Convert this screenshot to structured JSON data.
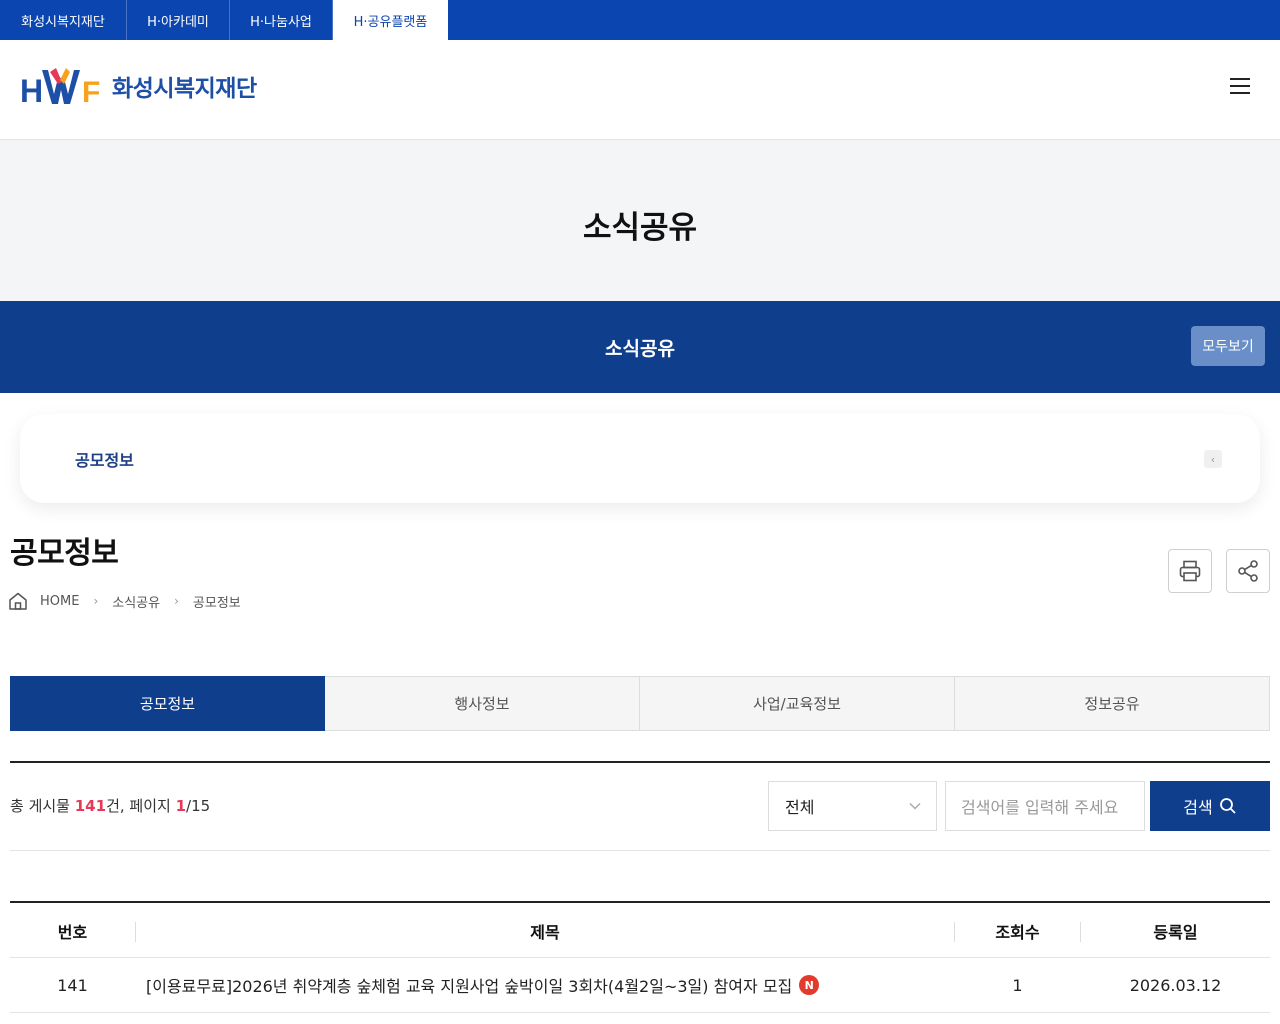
{
  "topbar": {
    "tabs": [
      {
        "label": "화성시복지재단"
      },
      {
        "label": "H·아카데미"
      },
      {
        "label": "H·나눔사업"
      },
      {
        "label": "H·공유플랫폼"
      }
    ]
  },
  "header": {
    "logo_text": "화성시복지재단",
    "logo_mark": "HWF"
  },
  "visual": {
    "title": "소식공유"
  },
  "subbar": {
    "title": "소식공유",
    "all_button": "모두보기"
  },
  "submenu": {
    "current": "공모정보"
  },
  "page": {
    "title": "공모정보"
  },
  "breadcrumb": {
    "home": "HOME",
    "level1": "소식공유",
    "level2": "공모정보"
  },
  "tabs": [
    {
      "label": "공모정보"
    },
    {
      "label": "행사정보"
    },
    {
      "label": "사업/교육정보"
    },
    {
      "label": "정보공유"
    }
  ],
  "board": {
    "count_prefix": "총 게시물 ",
    "total": "141",
    "count_mid": "건, 페이지 ",
    "page_current": "1",
    "page_total": "/15",
    "select_value": "전체",
    "search_placeholder": "검색어를 입력해 주세요",
    "search_button": "검색"
  },
  "table": {
    "headers": [
      "번호",
      "제목",
      "조회수",
      "등록일"
    ],
    "rows": [
      {
        "no": "141",
        "title": "[이용료무료]2026년 취약계층 숲체험 교육 지원사업 숲박이일 3회차(4월2일~3일) 참여자 모집",
        "badge": "N",
        "views": "1",
        "date": "2026.03.12"
      }
    ]
  },
  "colors": {
    "topbar": "#0b45b0",
    "primary": "#0f3f8c",
    "accent_red": "#e8385a",
    "logo_orange": "#f6a21b"
  },
  "icons": {
    "hamburger": "hamburger-menu-icon",
    "home": "home-icon",
    "print": "print-icon",
    "share": "share-icon",
    "search": "search-icon",
    "chevron": "chevron-down-icon"
  }
}
